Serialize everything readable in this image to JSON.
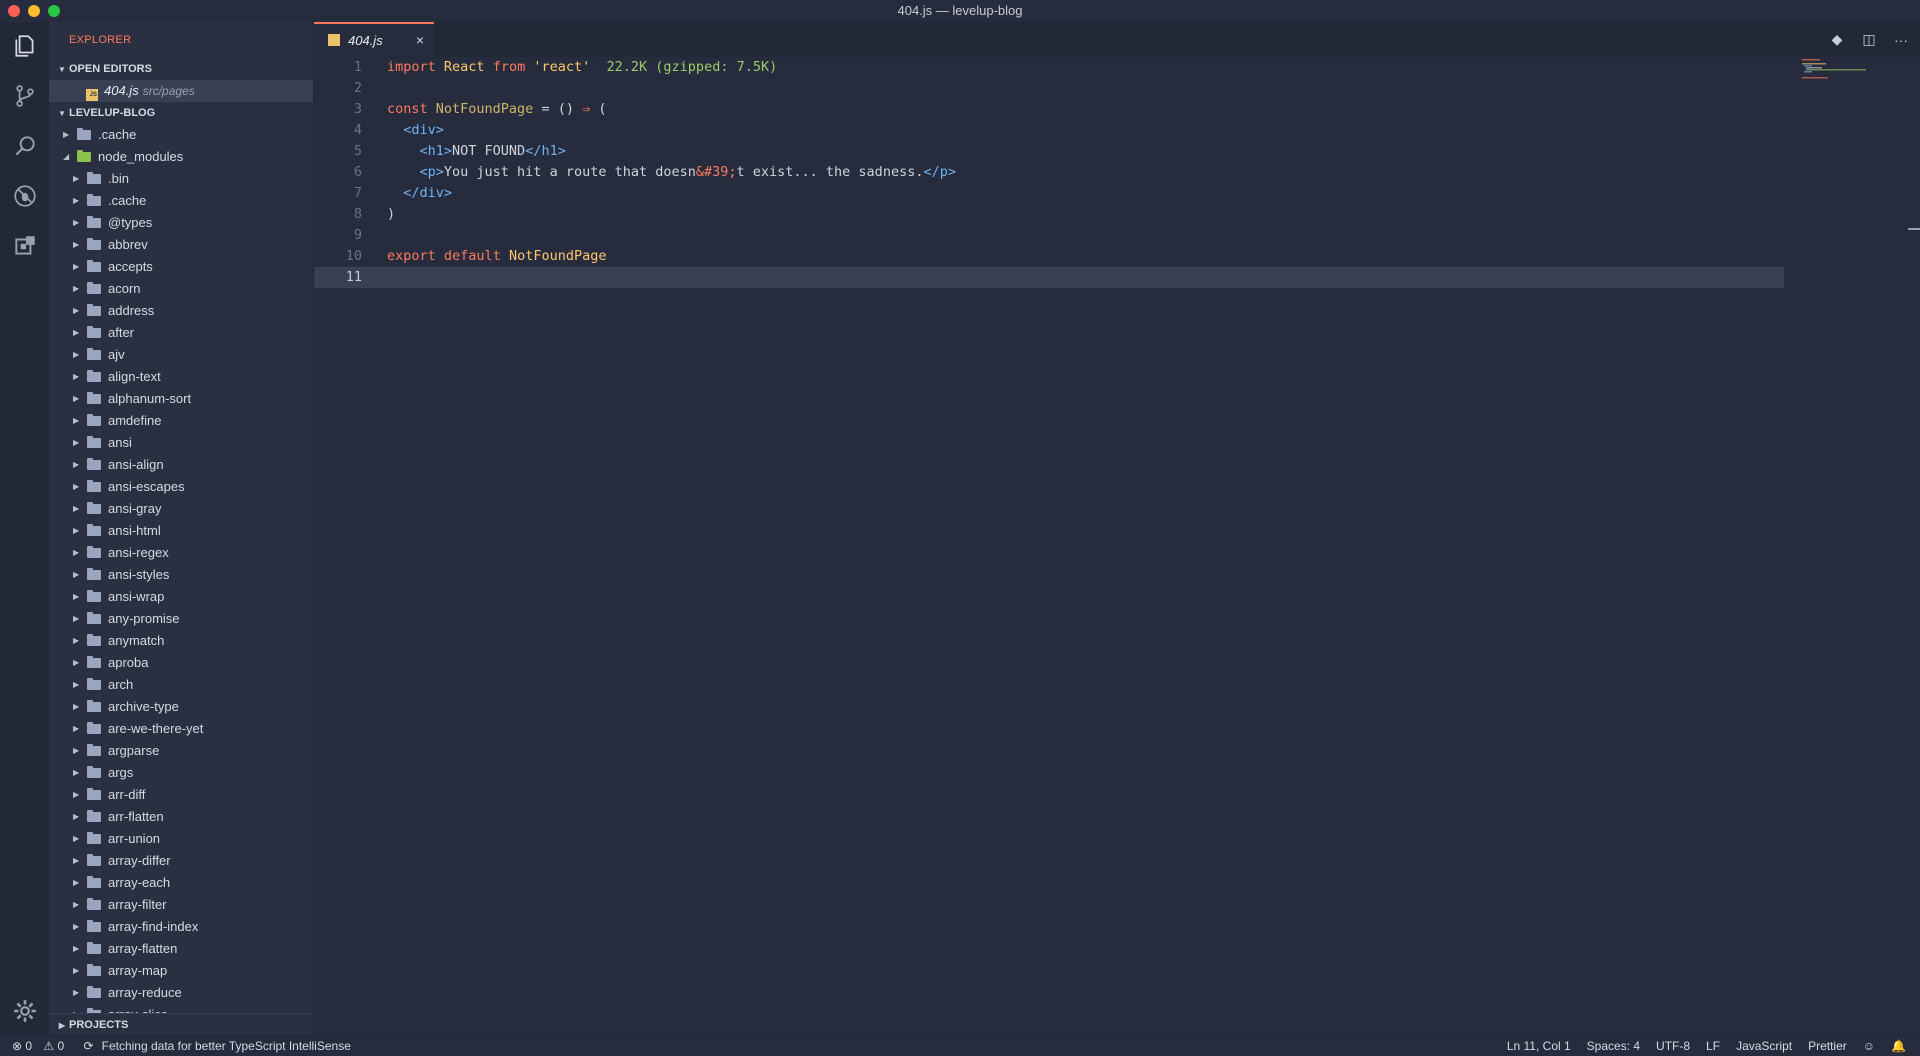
{
  "window": {
    "title": "404.js — levelup-blog"
  },
  "sidebar": {
    "title": "EXPLORER",
    "open_editors_label": "OPEN EDITORS",
    "open_editor": {
      "file": "404.js",
      "path": "src/pages"
    },
    "project_label": "LEVELUP-BLOG",
    "tree_top": [
      {
        "label": ".cache",
        "expanded": false
      },
      {
        "label": "node_modules",
        "expanded": true
      }
    ],
    "node_modules": [
      ".bin",
      ".cache",
      "@types",
      "abbrev",
      "accepts",
      "acorn",
      "address",
      "after",
      "ajv",
      "align-text",
      "alphanum-sort",
      "amdefine",
      "ansi",
      "ansi-align",
      "ansi-escapes",
      "ansi-gray",
      "ansi-html",
      "ansi-regex",
      "ansi-styles",
      "ansi-wrap",
      "any-promise",
      "anymatch",
      "aproba",
      "arch",
      "archive-type",
      "are-we-there-yet",
      "argparse",
      "args",
      "arr-diff",
      "arr-flatten",
      "arr-union",
      "array-differ",
      "array-each",
      "array-filter",
      "array-find-index",
      "array-flatten",
      "array-map",
      "array-reduce",
      "array-slice"
    ],
    "projects_label": "PROJECTS"
  },
  "tab": {
    "name": "404.js",
    "close": "×"
  },
  "code": {
    "line_numbers": [
      "1",
      "2",
      "3",
      "4",
      "5",
      "6",
      "7",
      "8",
      "9",
      "10",
      "11"
    ],
    "import_hint": "22.2K (gzipped: 7.5K)",
    "component_name": "NotFoundPage",
    "h1_text": "NOT FOUND",
    "p_text": "You just hit a route that doesn",
    "p_entity": "&#39;",
    "p_text2": "t exist... the sadness.",
    "current_line": "11"
  },
  "status": {
    "errors": "0",
    "warnings": "0",
    "message": "Fetching data for better TypeScript IntelliSense",
    "position": "Ln 11, Col 1",
    "spaces": "Spaces: 4",
    "encoding": "UTF-8",
    "eol": "LF",
    "language": "JavaScript",
    "formatter": "Prettier"
  },
  "colors": {
    "accent": "#ff7a5c",
    "background": "#262c3d",
    "sidebar": "#2a3041"
  }
}
